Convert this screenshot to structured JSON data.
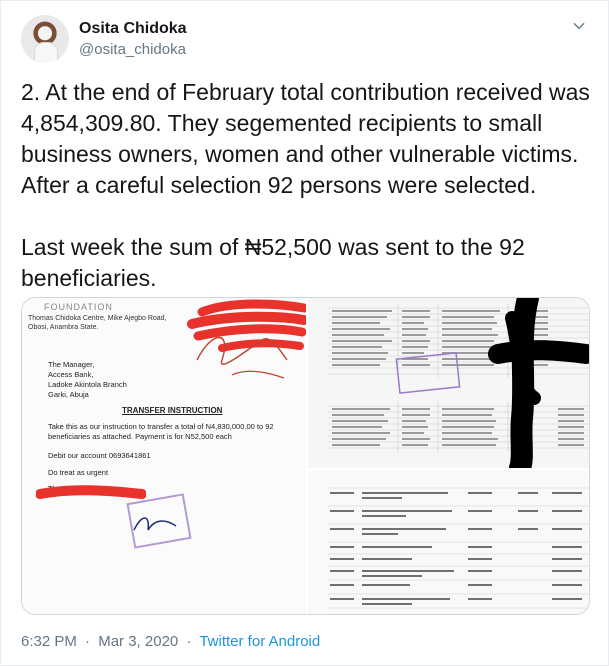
{
  "author": {
    "name": "Osita Chidoka",
    "handle": "@osita_chidoka"
  },
  "tweet": {
    "paragraph_1": "2. At the end of February total contribution received was 4,854,309.80. They segemented recipients to small business owners, women and other vulnerable victims. After a careful selection 92 persons were selected.",
    "paragraph_2": "Last week the sum of ₦52,500 was sent to the 92 beneficiaries."
  },
  "media": {
    "letter": {
      "foundation": "FOUNDATION",
      "address": "Thomas Chidoka Centre, Mike Ajegbo Road, Obosi, Anambra State.",
      "to_line_1": "The Manager,",
      "to_line_2": "Access Bank,",
      "to_line_3": "Ladoke Akintola Branch",
      "to_line_4": "Garki, Abuja",
      "subject": "TRANSFER INSTRUCTION",
      "body": "Take this as our instruction to transfer a total of N4,830,000.00 to 92 beneficiaries as attached. Payment is for N52,500 each",
      "debit": "Debit our account 0693641861",
      "urgent": "Do treat as urgent",
      "thanks": "Thank you"
    }
  },
  "footer": {
    "time": "6:32 PM",
    "separator": "·",
    "date": "Mar 3, 2020",
    "source": "Twitter for Android"
  },
  "colors": {
    "text": "#14171a",
    "muted": "#657786",
    "link": "#1b95e0",
    "redaction_red": "#e8322b",
    "redaction_black": "#000000",
    "stamp_purple": "#7f56c2"
  },
  "icons": {
    "menu": "chevron-down-icon"
  }
}
